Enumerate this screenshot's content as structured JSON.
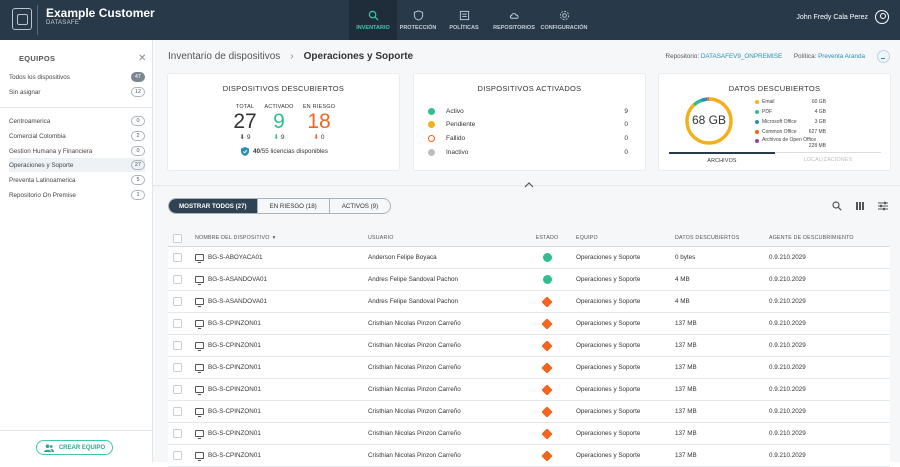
{
  "app": {
    "company": "Example Customer",
    "product": "DATASAFE"
  },
  "nav": [
    {
      "label": "INVENTARIO",
      "icon": "search-icon",
      "active": true
    },
    {
      "label": "PROTECCIÓN",
      "icon": "shield-icon",
      "active": false
    },
    {
      "label": "POLÍTICAS",
      "icon": "document-icon",
      "active": false
    },
    {
      "label": "REPOSITORIOS",
      "icon": "cloud-icon",
      "active": false
    },
    {
      "label": "CONFIGURACIÓN",
      "icon": "gear-icon",
      "active": false
    }
  ],
  "user": {
    "name": "John Fredy Cala Perez"
  },
  "sidebar": {
    "title": "EQUIPOS",
    "items": [
      {
        "label": "Todos los dispositivos",
        "count": "47"
      },
      {
        "label": "Sin asignar",
        "count": "12"
      },
      {
        "label": "Centroamerica",
        "count": "0"
      },
      {
        "label": "Comercial Colombia",
        "count": "2"
      },
      {
        "label": "Gestion Humana y Financiera",
        "count": "0"
      },
      {
        "label": "Operaciones y Soporte",
        "count": "27"
      },
      {
        "label": "Preventa Latinoamerica",
        "count": "5"
      },
      {
        "label": "Repositorio On Premise",
        "count": "1"
      }
    ],
    "create_button": "CREAR EQUIPO"
  },
  "breadcrumb": {
    "parent": "Inventario de dispositivos",
    "current": "Operaciones y Soporte"
  },
  "header": {
    "repo_label": "Repositorio:",
    "repo_value": "DATASAFEV9_ONPREMISE",
    "policy_label": "Política:",
    "policy_value": "Preventa Aranda"
  },
  "discovered": {
    "title": "DISPOSITIVOS DESCUBIERTOS",
    "total_label": "TOTAL",
    "total": "27",
    "total_delta": "9",
    "active_label": "ACTIVADO",
    "active": "9",
    "active_delta": "9",
    "risk_label": "EN RIESGO",
    "risk": "18",
    "risk_delta": "0",
    "licenses": "40",
    "licenses_text": "/55 licencias disponibles"
  },
  "activated": {
    "title": "DISPOSITIVOS ACTIVADOS",
    "rows": [
      {
        "label": "Activo",
        "value": "9",
        "color": "#2fbf8d"
      },
      {
        "label": "Pendiente",
        "value": "0",
        "color": "#f2b01e"
      },
      {
        "label": "Fallido",
        "value": "0",
        "color": "#f0651f"
      },
      {
        "label": "Inactivo",
        "value": "0",
        "color": "#b8bec4"
      }
    ]
  },
  "data_card": {
    "title": "DATOS DESCUBIERTOS",
    "total": "68 GB",
    "legend": [
      {
        "label": "Email",
        "value": "60 GB",
        "color": "#f2b01e",
        "share": 0.88
      },
      {
        "label": "PDF",
        "value": "4 GB",
        "color": "#2fbf8d",
        "share": 0.06
      },
      {
        "label": "Microsoft Office",
        "value": "3 GB",
        "color": "#2a8fb5",
        "share": 0.045
      },
      {
        "label": "Common Office",
        "value": "627 MB",
        "color": "#f0651f",
        "share": 0.01
      },
      {
        "label": "Archivos de Open Office",
        "value": "228 MB",
        "color": "#8e44ad",
        "share": 0.005
      }
    ],
    "tabs": [
      "ARCHIVOS",
      "LOCALIZACIONES"
    ]
  },
  "filters": [
    "MOSTRAR TODOS (27)",
    "EN RIESGO (18)",
    "ACTIVOS (9)"
  ],
  "tools": [
    "search-icon",
    "columns-icon",
    "filter-settings-icon"
  ],
  "table": {
    "headers": [
      "NOMBRE DEL DISPOSITIVO",
      "USUARIO",
      "ESTADO",
      "EQUIPO",
      "DATOS DESCUBIERTOS",
      "AGENTE DE DESCUBRIMIENTO"
    ],
    "rows": [
      {
        "device": "BG-S-ABOYACA01",
        "user": "Anderson Felipe Boyaca",
        "status": "ok",
        "team": "Operaciones y Soporte",
        "data": "0 bytes",
        "agent": "0.9.210.2029"
      },
      {
        "device": "BG-S-ASANDOVA01",
        "user": "Andres Felipe Sandoval Pachon",
        "status": "ok",
        "team": "Operaciones y Soporte",
        "data": "4 MB",
        "agent": "0.9.210.2029"
      },
      {
        "device": "BG-S-ASANDOVA01",
        "user": "Andres Felipe Sandoval Pachon",
        "status": "risk",
        "team": "Operaciones y Soporte",
        "data": "4 MB",
        "agent": "0.9.210.2029"
      },
      {
        "device": "BG-S-CPINZON01",
        "user": "Cristhian Nicolas Pinzon Carreño",
        "status": "risk",
        "team": "Operaciones y Soporte",
        "data": "137 MB",
        "agent": "0.9.210.2029"
      },
      {
        "device": "BG-S-CPINZON01",
        "user": "Cristhian Nicolas Pinzon Carreño",
        "status": "risk",
        "team": "Operaciones y Soporte",
        "data": "137 MB",
        "agent": "0.9.210.2029"
      },
      {
        "device": "BG-S-CPINZON01",
        "user": "Cristhian Nicolas Pinzon Carreño",
        "status": "risk",
        "team": "Operaciones y Soporte",
        "data": "137 MB",
        "agent": "0.9.210.2029"
      },
      {
        "device": "BG-S-CPINZON01",
        "user": "Cristhian Nicolas Pinzon Carreño",
        "status": "risk",
        "team": "Operaciones y Soporte",
        "data": "137 MB",
        "agent": "0.9.210.2029"
      },
      {
        "device": "BG-S-CPINZON01",
        "user": "Cristhian Nicolas Pinzon Carreño",
        "status": "risk",
        "team": "Operaciones y Soporte",
        "data": "137 MB",
        "agent": "0.9.210.2029"
      },
      {
        "device": "BG-S-CPINZON01",
        "user": "Cristhian Nicolas Pinzon Carreño",
        "status": "risk",
        "team": "Operaciones y Soporte",
        "data": "137 MB",
        "agent": "0.9.210.2029"
      },
      {
        "device": "BG-S-CPINZON01",
        "user": "Cristhian Nicolas Pinzon Carreño",
        "status": "risk",
        "team": "Operaciones y Soporte",
        "data": "137 MB",
        "agent": "0.9.210.2029"
      }
    ]
  }
}
